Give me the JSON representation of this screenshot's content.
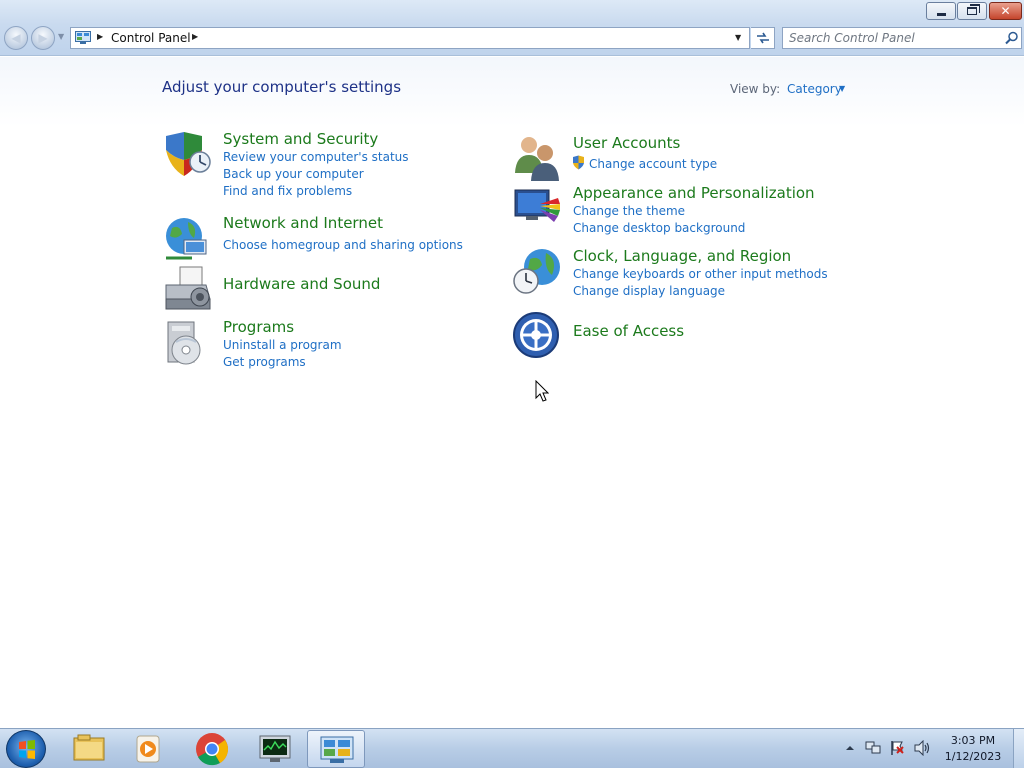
{
  "window": {
    "minimize_glyph": "",
    "close_glyph": "✕"
  },
  "address_bar": {
    "path": "Control Panel"
  },
  "search": {
    "placeholder": "Search Control Panel"
  },
  "page": {
    "title": "Adjust your computer's settings",
    "view_by_label": "View by:",
    "view_by_value": "Category"
  },
  "categories": {
    "system_security": {
      "heading": "System and Security",
      "links": [
        "Review your computer's status",
        "Back up your computer",
        "Find and fix problems"
      ],
      "icon": "shield-icon"
    },
    "network_internet": {
      "heading": "Network and Internet",
      "links": [
        "Choose homegroup and sharing options"
      ],
      "icon": "network-globe-icon"
    },
    "hardware_sound": {
      "heading": "Hardware and Sound",
      "links": [],
      "icon": "printer-icon"
    },
    "programs": {
      "heading": "Programs",
      "links": [
        "Uninstall a program",
        "Get programs"
      ],
      "icon": "programs-disc-icon"
    },
    "user_accounts": {
      "heading": "User Accounts",
      "links": [
        "Change account type"
      ],
      "icon": "users-icon"
    },
    "appearance": {
      "heading": "Appearance and Personalization",
      "links": [
        "Change the theme",
        "Change desktop background"
      ],
      "icon": "monitor-paint-icon"
    },
    "clock_region": {
      "heading": "Clock, Language, and Region",
      "links": [
        "Change keyboards or other input methods",
        "Change display language"
      ],
      "icon": "clock-globe-icon"
    },
    "ease_access": {
      "heading": "Ease of Access",
      "links": [],
      "icon": "ease-of-access-icon"
    }
  },
  "taskbar": {
    "items": [
      "start-orb-icon",
      "file-explorer-icon",
      "media-player-icon",
      "chrome-icon",
      "task-manager-icon",
      "control-panel-icon"
    ],
    "clock_time": "3:03 PM",
    "clock_date": "1/12/2023"
  },
  "colors": {
    "heading_green": "#1c7a1c",
    "link_blue": "#1f6fc5",
    "title_blue": "#1e3287"
  }
}
